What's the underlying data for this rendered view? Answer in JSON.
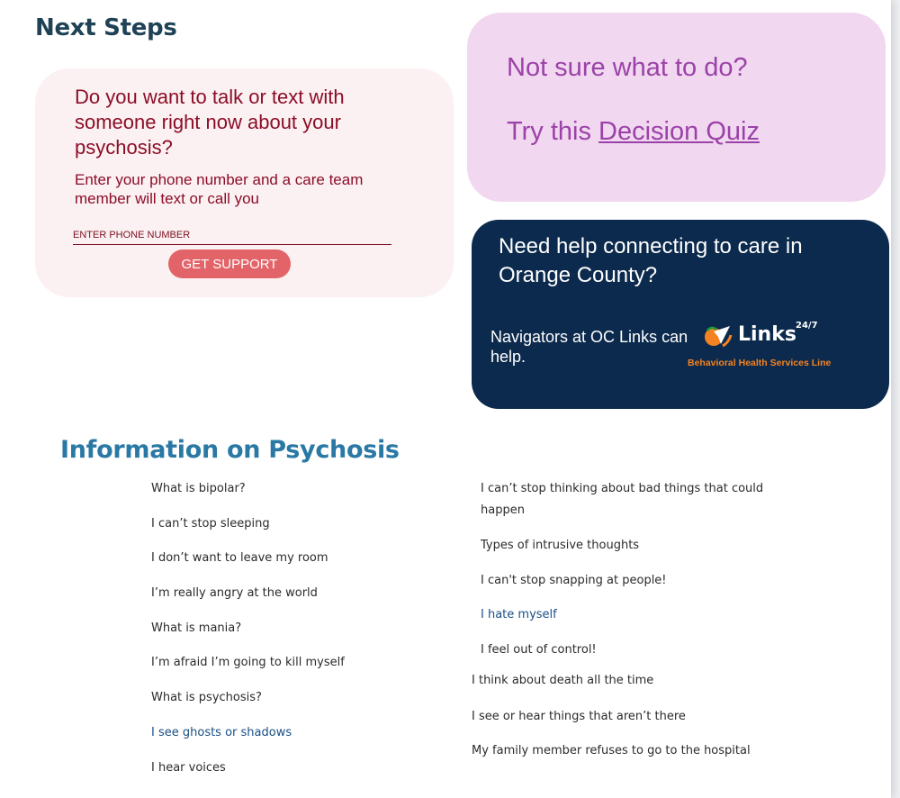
{
  "header": {
    "title": "Next Steps"
  },
  "talk_card": {
    "title": "Do you want to talk or text with someone right now about your psychosis?",
    "description": "Enter your phone number and a care team member will text or call you",
    "phone_placeholder": "ENTER PHONE NUMBER",
    "button_label": "GET SUPPORT"
  },
  "quiz_card": {
    "line1": "Not sure what to do?",
    "line2_prefix": "Try this ",
    "link_text": "Decision Quiz"
  },
  "oc_card": {
    "title": "Need help connecting to care in Orange County?",
    "description": "Navigators at OC Links can help.",
    "logo_word": "Links",
    "logo_superscript": "24/7",
    "logo_tagline": "Behavioral Health Services Line"
  },
  "info": {
    "heading": "Information on Psychosis",
    "left_items": [
      "What is bipolar?",
      "I can’t stop sleeping",
      "I don’t want to leave my room",
      "I’m really angry at the world",
      "What is mania?",
      "I’m afraid I’m going to kill myself",
      "What is psychosis?",
      "I see ghosts or shadows",
      "I hear voices"
    ],
    "right_items_a": [
      "I can’t stop thinking about bad things that could happen",
      "Types of intrusive thoughts",
      "I can't stop snapping at people!",
      "I hate myself",
      "I feel out of control!"
    ],
    "right_items_b": [
      "I think about death all the time",
      "I see or hear things that aren’t there",
      "My family member refuses to go to the hospital"
    ]
  },
  "colors": {
    "heading": "#1f4257",
    "talk_bg": "#fbf1f2",
    "talk_text": "#8c0d27",
    "button": "#e26468",
    "quiz_bg": "#f1d7ef",
    "quiz_text": "#9b42a8",
    "oc_bg": "#0c2a4d",
    "oc_orange": "#f58220",
    "info_heading": "#2a79a5",
    "link_text": "#1a4f86"
  },
  "icons": {
    "oc_logo": "orange-paper-plane-icon"
  }
}
